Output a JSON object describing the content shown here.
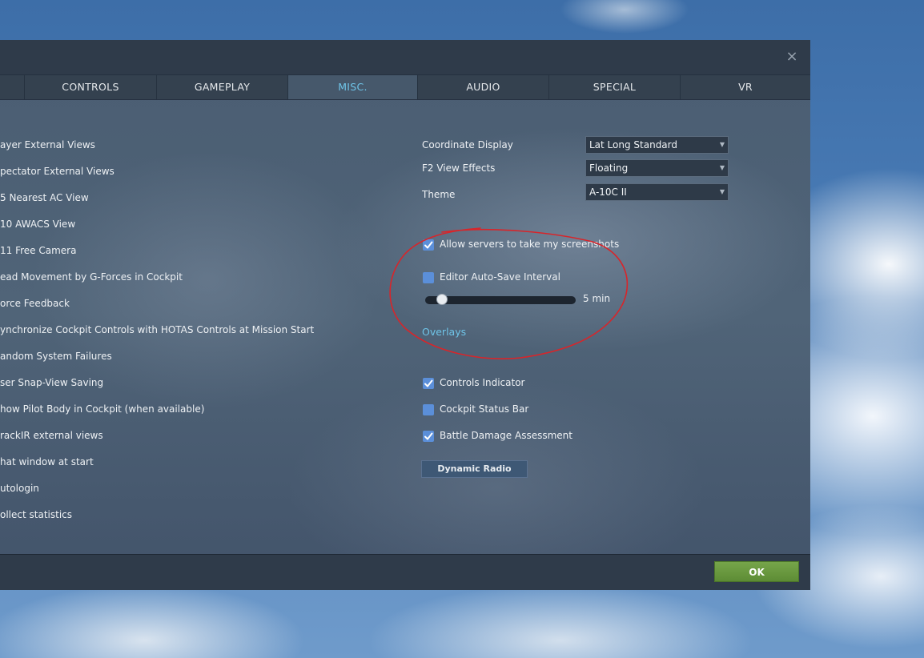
{
  "dialog": {
    "close_glyph": "×",
    "tabs": [
      {
        "label": "CONTROLS"
      },
      {
        "label": "GAMEPLAY"
      },
      {
        "label": "MISC."
      },
      {
        "label": "AUDIO"
      },
      {
        "label": "SPECIAL"
      },
      {
        "label": "VR"
      }
    ],
    "active_tab": "MISC."
  },
  "left_options": [
    "ayer External Views",
    "pectator External Views",
    "5 Nearest AC View",
    "10 AWACS View",
    "11 Free Camera",
    "ead Movement by G-Forces in Cockpit",
    "orce Feedback",
    "ynchronize Cockpit Controls with HOTAS Controls at Mission Start",
    "andom System Failures",
    "ser Snap-View Saving",
    "how Pilot Body in Cockpit (when available)",
    "rackIR external views",
    "hat window at start",
    "utologin",
    "ollect statistics"
  ],
  "right": {
    "coordinate_display": {
      "label": "Coordinate Display",
      "value": "Lat Long Standard"
    },
    "f2_view_effects": {
      "label": "F2 View Effects",
      "value": "Floating"
    },
    "theme": {
      "label": "Theme",
      "value": "A-10C II"
    },
    "allow_screenshots": {
      "label": "Allow servers to take my screenshots",
      "checked": true
    },
    "editor_autosave": {
      "label": "Editor Auto-Save Interval",
      "checked": false
    },
    "autosave_slider": {
      "value_label": "5 min",
      "fraction": 0.08
    },
    "overlays_label": "Overlays",
    "controls_indicator": {
      "label": "Controls Indicator",
      "checked": true
    },
    "cockpit_status_bar": {
      "label": "Cockpit Status Bar",
      "checked": false
    },
    "battle_damage": {
      "label": "Battle Damage Assessment",
      "checked": true
    },
    "dynamic_radio_label": "Dynamic Radio"
  },
  "footer": {
    "ok_label": "OK"
  },
  "colors": {
    "accent": "#6fc4e8",
    "ok_green": "#6a9a40",
    "annotation_red": "#d8252a"
  }
}
